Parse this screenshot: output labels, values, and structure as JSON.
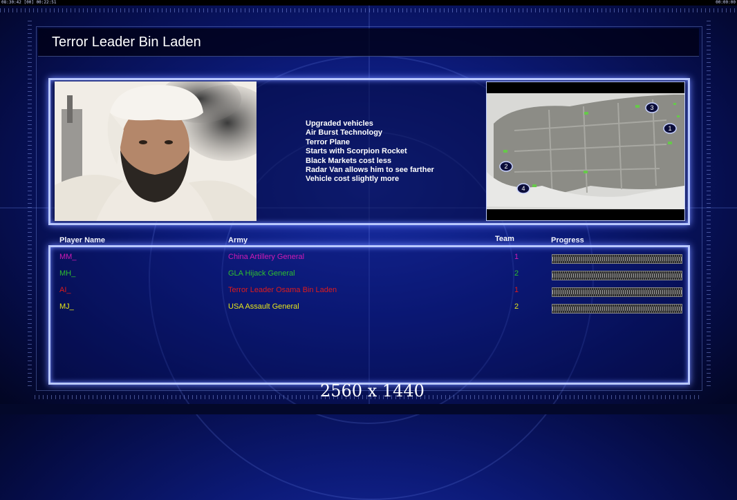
{
  "status_bar": {
    "left_text": "08:30:42 [00] 00:22:51",
    "right_text": "00:00:00"
  },
  "title": "Terror Leader Bin Laden",
  "portrait": {
    "subject": "leader-portrait"
  },
  "traits": [
    "Upgraded vehicles",
    "Air Burst Technology",
    "Terror Plane",
    "Starts with Scorpion Rocket",
    "Black Markets cost less",
    "Radar Van allows him to see farther",
    "Vehicle cost slightly more"
  ],
  "minimap": {
    "start_positions": [
      "1",
      "2",
      "3",
      "4"
    ]
  },
  "table": {
    "headers": {
      "player_name": "Player Name",
      "army": "Army",
      "team": "Team",
      "progress": "Progress"
    },
    "rows": [
      {
        "name": "MM_",
        "army": "China Artillery General",
        "team": "1",
        "color": "#d11ab5"
      },
      {
        "name": "MH_",
        "army": "GLA Hijack General",
        "team": "2",
        "color": "#2fbf2f"
      },
      {
        "name": "AI_",
        "army": "Terror Leader Osama Bin Laden",
        "team": "1",
        "color": "#e01b1b"
      },
      {
        "name": "MJ_",
        "army": "USA Assault General",
        "team": "2",
        "color": "#e6e61a"
      }
    ]
  },
  "overlay": {
    "resolution": "2560 x 1440"
  }
}
